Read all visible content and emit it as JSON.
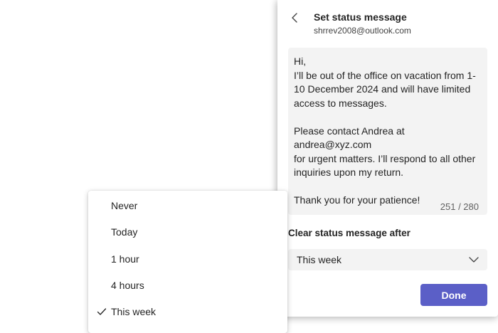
{
  "panel": {
    "title": "Set status message",
    "subtitle": "shrrev2008@outlook.com",
    "message": "Hi,\nI’ll be out of the office on vacation from 1-\n10 December 2024 and will have limited\naccess to messages.\n\nPlease contact Andrea at andrea@xyz.com\nfor urgent matters. I’ll respond to all other\ninquiries upon my return.\n\nThank you for your patience!",
    "counter": "251 / 280",
    "clear_label": "Clear status message after",
    "selected_duration": "This week",
    "done_label": "Done"
  },
  "dropdown": {
    "options": [
      "Never",
      "Today",
      "1 hour",
      "4 hours",
      "This week"
    ],
    "selected_index": 4
  },
  "colors": {
    "accent": "#5b5fc7",
    "field_bg": "#f3f3f3"
  }
}
